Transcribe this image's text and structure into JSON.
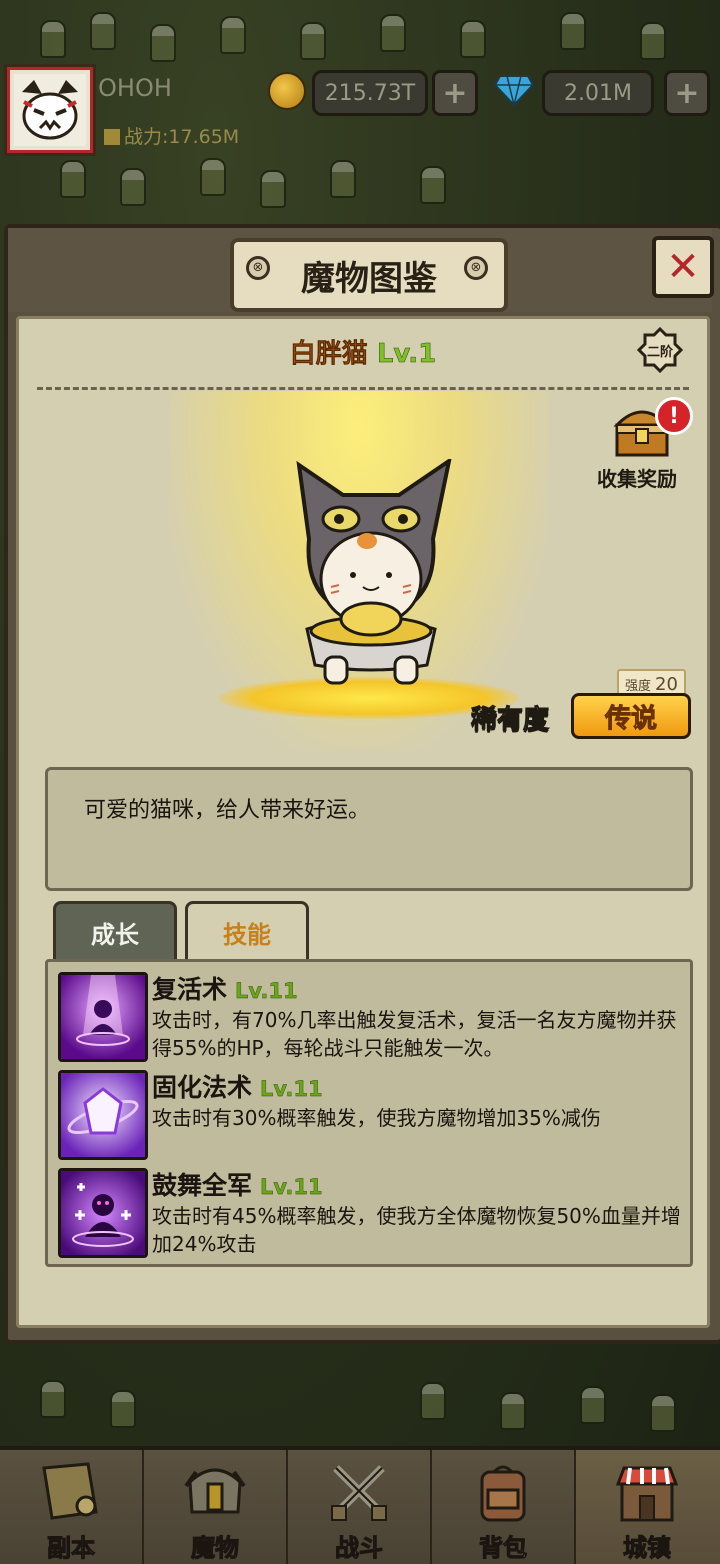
{
  "player": {
    "name": "OHOH",
    "power": "战力:17.65M"
  },
  "resources": {
    "gold": "215.73T",
    "gems": "2.01M",
    "plus": "+"
  },
  "panel": {
    "title": "魔物图鉴",
    "close": "✕",
    "screw": "⊗"
  },
  "monster": {
    "name": "白胖猫",
    "level": "Lv.1",
    "tier": "二阶",
    "collect_label": "收集奖励",
    "alert": "!",
    "strength_label": "强度",
    "strength_value": "20",
    "rarity_label": "稀有度",
    "rarity_value": "传说",
    "description": "可爱的猫咪，给人带来好运。"
  },
  "tabs": [
    {
      "label": "成长",
      "active": false
    },
    {
      "label": "技能",
      "active": true
    }
  ],
  "skills": [
    {
      "name": "复活术",
      "level": "Lv.11",
      "icon": "resurrect-icon",
      "desc": "攻击时，有70%几率出触发复活术，复活一名友方魔物并获得55%的HP，每轮战斗只能触发一次。"
    },
    {
      "name": "固化法术",
      "level": "Lv.11",
      "icon": "crystal-shield-icon",
      "desc": "攻击时有30%概率触发，使我方魔物增加35%减伤"
    },
    {
      "name": "鼓舞全军",
      "level": "Lv.11",
      "icon": "inspire-icon",
      "desc": "攻击时有45%概率触发，使我方全体魔物恢复50%血量并增加24%攻击"
    }
  ],
  "nav": [
    {
      "label": "副本",
      "icon": "map-scroll-icon"
    },
    {
      "label": "魔物",
      "icon": "knight-helmet-icon"
    },
    {
      "label": "战斗",
      "icon": "crossed-swords-icon"
    },
    {
      "label": "背包",
      "icon": "backpack-icon"
    },
    {
      "label": "城镇",
      "icon": "town-shop-icon"
    }
  ],
  "colors": {
    "rarity_legend": "#f5a21a",
    "level_green": "#7ec02a",
    "name_orange": "#d66a1a",
    "skill_purple": "#8a2ad8"
  }
}
